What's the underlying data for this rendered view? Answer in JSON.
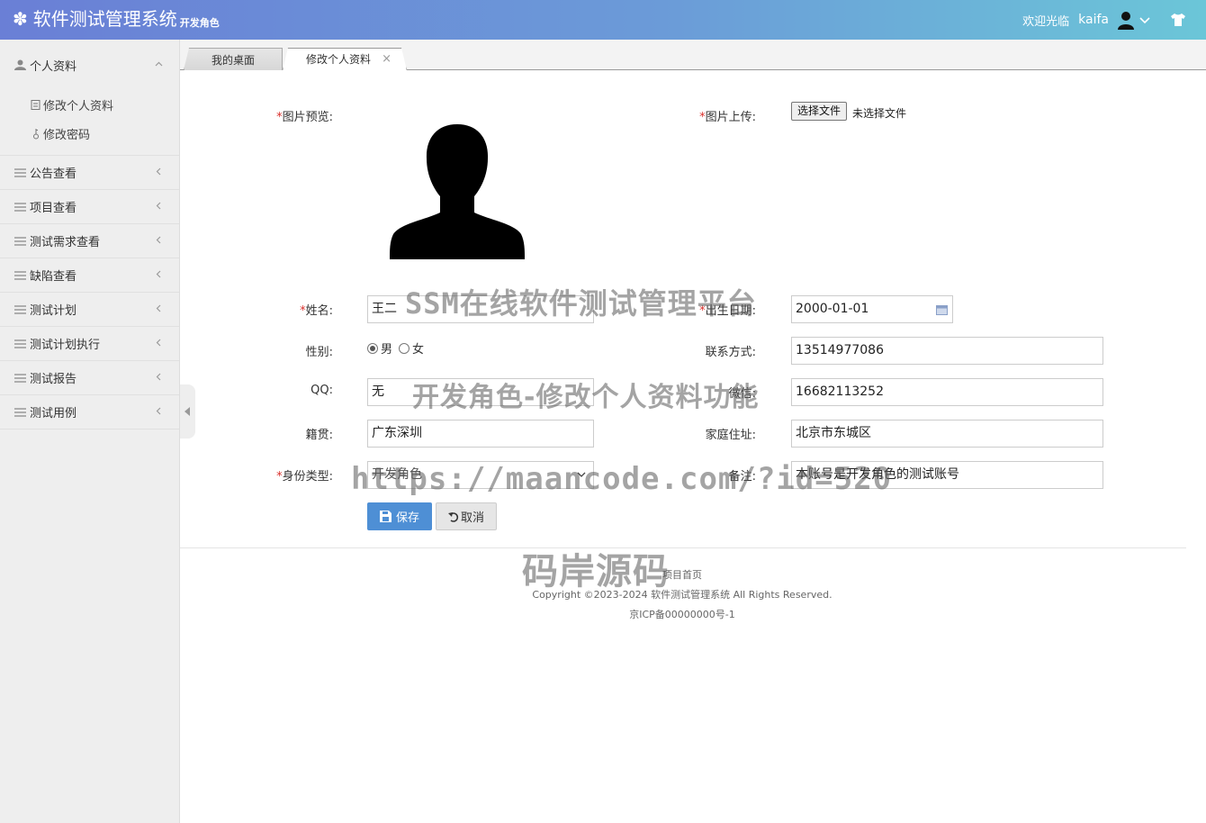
{
  "header": {
    "app_title": "软件测试管理系统",
    "role_label": "开发角色",
    "welcome": "欢迎光临",
    "username": "kaifa"
  },
  "sidebar": {
    "groups": [
      {
        "label": "个人资料",
        "expanded": true,
        "items": [
          {
            "label": "修改个人资料"
          },
          {
            "label": "修改密码"
          }
        ]
      },
      {
        "label": "公告查看"
      },
      {
        "label": "项目查看"
      },
      {
        "label": "测试需求查看"
      },
      {
        "label": "缺陷查看"
      },
      {
        "label": "测试计划"
      },
      {
        "label": "测试计划执行"
      },
      {
        "label": "测试报告"
      },
      {
        "label": "测试用例"
      }
    ]
  },
  "tabs": [
    {
      "label": "我的桌面"
    },
    {
      "label": "修改个人资料",
      "active": true,
      "close": "×"
    }
  ],
  "form": {
    "image_preview_label": "图片预览:",
    "image_upload_label": "图片上传:",
    "file_button": "选择文件",
    "file_status": "未选择文件",
    "name_label": "姓名:",
    "name_value": "王二",
    "birth_label": "出生日期:",
    "birth_value": "2000-01-01",
    "gender_label": "性别:",
    "gender_options": [
      "男",
      "女"
    ],
    "gender_selected": "男",
    "contact_label": "联系方式:",
    "contact_value": "13514977086",
    "qq_label": "QQ:",
    "qq_value": "无",
    "wechat_label": "微信:",
    "wechat_value": "16682113252",
    "native_label": "籍贯:",
    "native_value": "广东深圳",
    "address_label": "家庭住址:",
    "address_value": "北京市东城区",
    "identity_label": "身份类型:",
    "identity_value": "开发角色",
    "remark_label": "备注:",
    "remark_value": "本账号是开发角色的测试账号",
    "save_label": "保存",
    "cancel_label": "取消",
    "required_mark": "*"
  },
  "footer": {
    "home_link": "项目首页",
    "copyright": "Copyright ©2023-2024 软件测试管理系统 All Rights Reserved.",
    "icp": "京ICP备00000000号-1"
  },
  "watermarks": {
    "line1": "SSM在线软件测试管理平台",
    "line2": "开发角色-修改个人资料功能",
    "line3": "https://maancode.com/?id=520",
    "line4": "码岸源码"
  },
  "colors": {
    "header_gradient_start": "#6a7fd6",
    "header_gradient_end": "#6bc6d8",
    "save_button": "#4e8fd5",
    "required": "#d9302c",
    "sidebar_bg": "#eeeeee"
  }
}
